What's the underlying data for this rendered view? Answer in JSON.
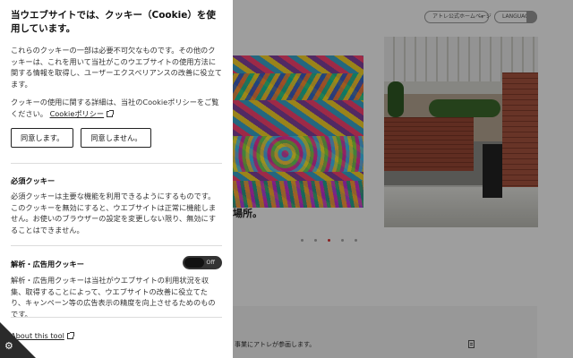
{
  "site": {
    "header": {
      "official_link": "アトレ公式ホームページ",
      "language_button": "LANGUAGE"
    },
    "hero": {
      "caption": "",
      "place_text": "場所。"
    },
    "slider_dots": [
      {
        "active": false
      },
      {
        "active": false
      },
      {
        "active": true
      },
      {
        "active": false
      },
      {
        "active": false
      }
    ],
    "news": {
      "text": "事業にアトレが参画します。"
    }
  },
  "cookie_panel": {
    "title": "当ウエブサイトでは、クッキー（Cookie）を使用しています。",
    "description": "これらのクッキーの一部は必要不可欠なものです。その他のクッキーは、これを用いて当社がこのウエブサイトの使用方法に関する情報を取得し、ユーザーエクスペリアンスの改善に役立てます。",
    "policy_text": "クッキーの使用に関する詳細は、当社のCookieポリシーをご覧ください。",
    "policy_link": "Cookieポリシー",
    "accept_button": "同意します。",
    "reject_button": "同意しません。",
    "necessary": {
      "title": "必須クッキー",
      "description": "必須クッキーは主要な機能を利用できるようにするものです。このクッキーを無効にすると、ウエブサイトは正常に機能しません。お使いのブラウザーの設定を変更しない限り、無効にすることはできません。"
    },
    "analytics": {
      "title": "解析・広告用クッキー",
      "toggle_label": "Off",
      "description": "解析・広告用クッキーは当社がウエブサイトの利用状況を収集、取得することによって、ウエブサイトの改善に役立てたり、キャンペーン等の広告表示の精度を向上させるためのものです。"
    },
    "about_link": "About this tool"
  }
}
